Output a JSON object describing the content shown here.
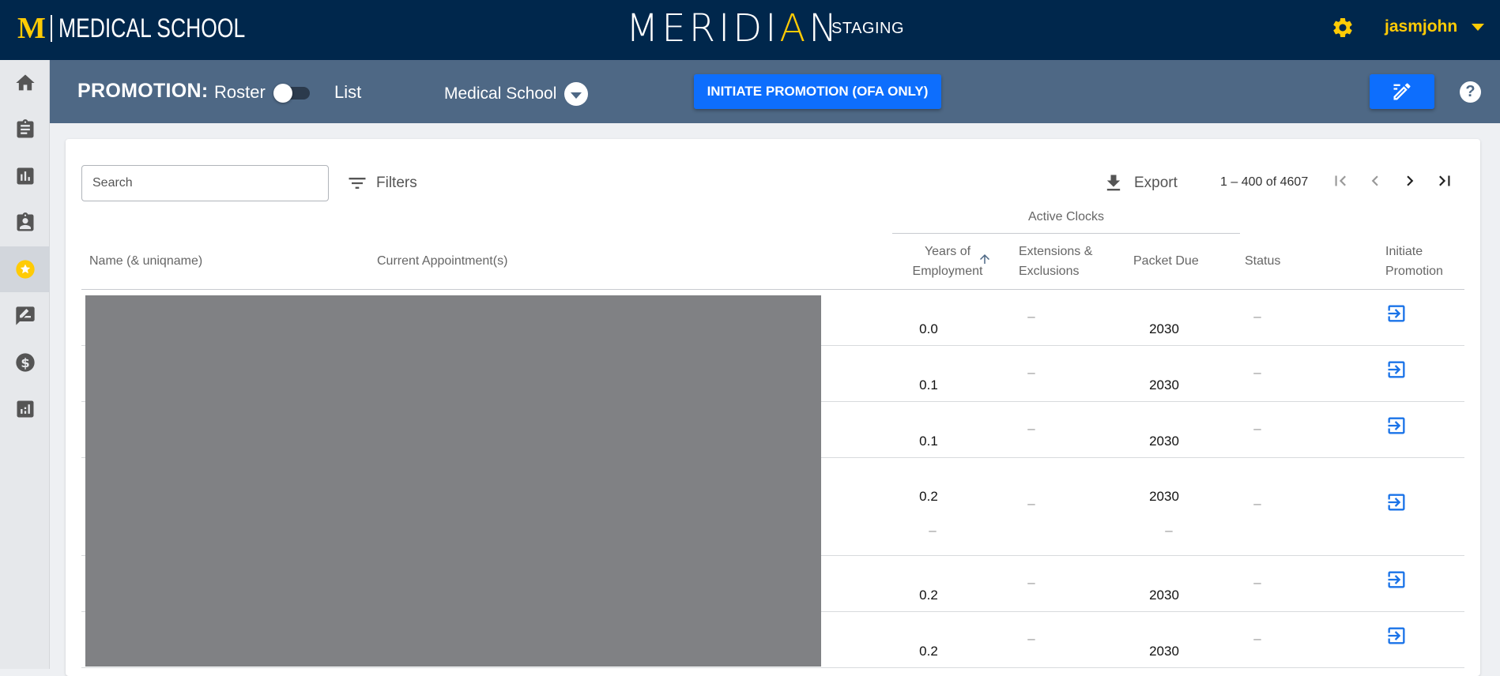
{
  "header": {
    "brand_mark": "M",
    "brand_text": "MEDICAL SCHOOL",
    "logo_pre": "MERIDI",
    "logo_accent": "A",
    "logo_post": "N",
    "env": "STAGING",
    "username": "jasmjohn",
    "accent_color": "#ffcb05",
    "bg_color": "#00274c"
  },
  "sidebar": {
    "items": [
      {
        "icon": "home-icon"
      },
      {
        "icon": "clipboard-icon"
      },
      {
        "icon": "bar-chart-icon"
      },
      {
        "icon": "badge-icon"
      },
      {
        "icon": "star-icon",
        "active": true
      },
      {
        "icon": "rate-review-icon"
      },
      {
        "icon": "dollar-icon"
      },
      {
        "icon": "analytics-icon"
      }
    ]
  },
  "subbar": {
    "title": "PROMOTION:",
    "toggle_left": "Roster",
    "toggle_right": "List",
    "school": "Medical School",
    "initiate_label": "INITIATE PROMOTION (OFA ONLY)",
    "help": "?"
  },
  "toolbar": {
    "search_placeholder": "Search",
    "filters_label": "Filters",
    "export_label": "Export",
    "range": "1 – 400 of 4607"
  },
  "table": {
    "group_header": "Active Clocks",
    "columns": {
      "name": "Name (& uniqname)",
      "appointment": "Current Appointment(s)",
      "years_l1": "Years of",
      "years_l2": "Employment",
      "ext_l1": "Extensions &",
      "ext_l2": "Exclusions",
      "packet": "Packet Due",
      "status": "Status",
      "initiate_l1": "Initiate",
      "initiate_l2": "Promotion"
    },
    "dash": "–",
    "rows": [
      {
        "years": "0.0",
        "packet": "2030"
      },
      {
        "years": "0.1",
        "packet": "2030"
      },
      {
        "years": "0.1",
        "packet": "2030"
      },
      {
        "years": "0.2",
        "packet": "2030"
      },
      {
        "years": "0.2",
        "packet": "2030"
      },
      {
        "years": "0.2",
        "packet": "2030"
      }
    ]
  }
}
